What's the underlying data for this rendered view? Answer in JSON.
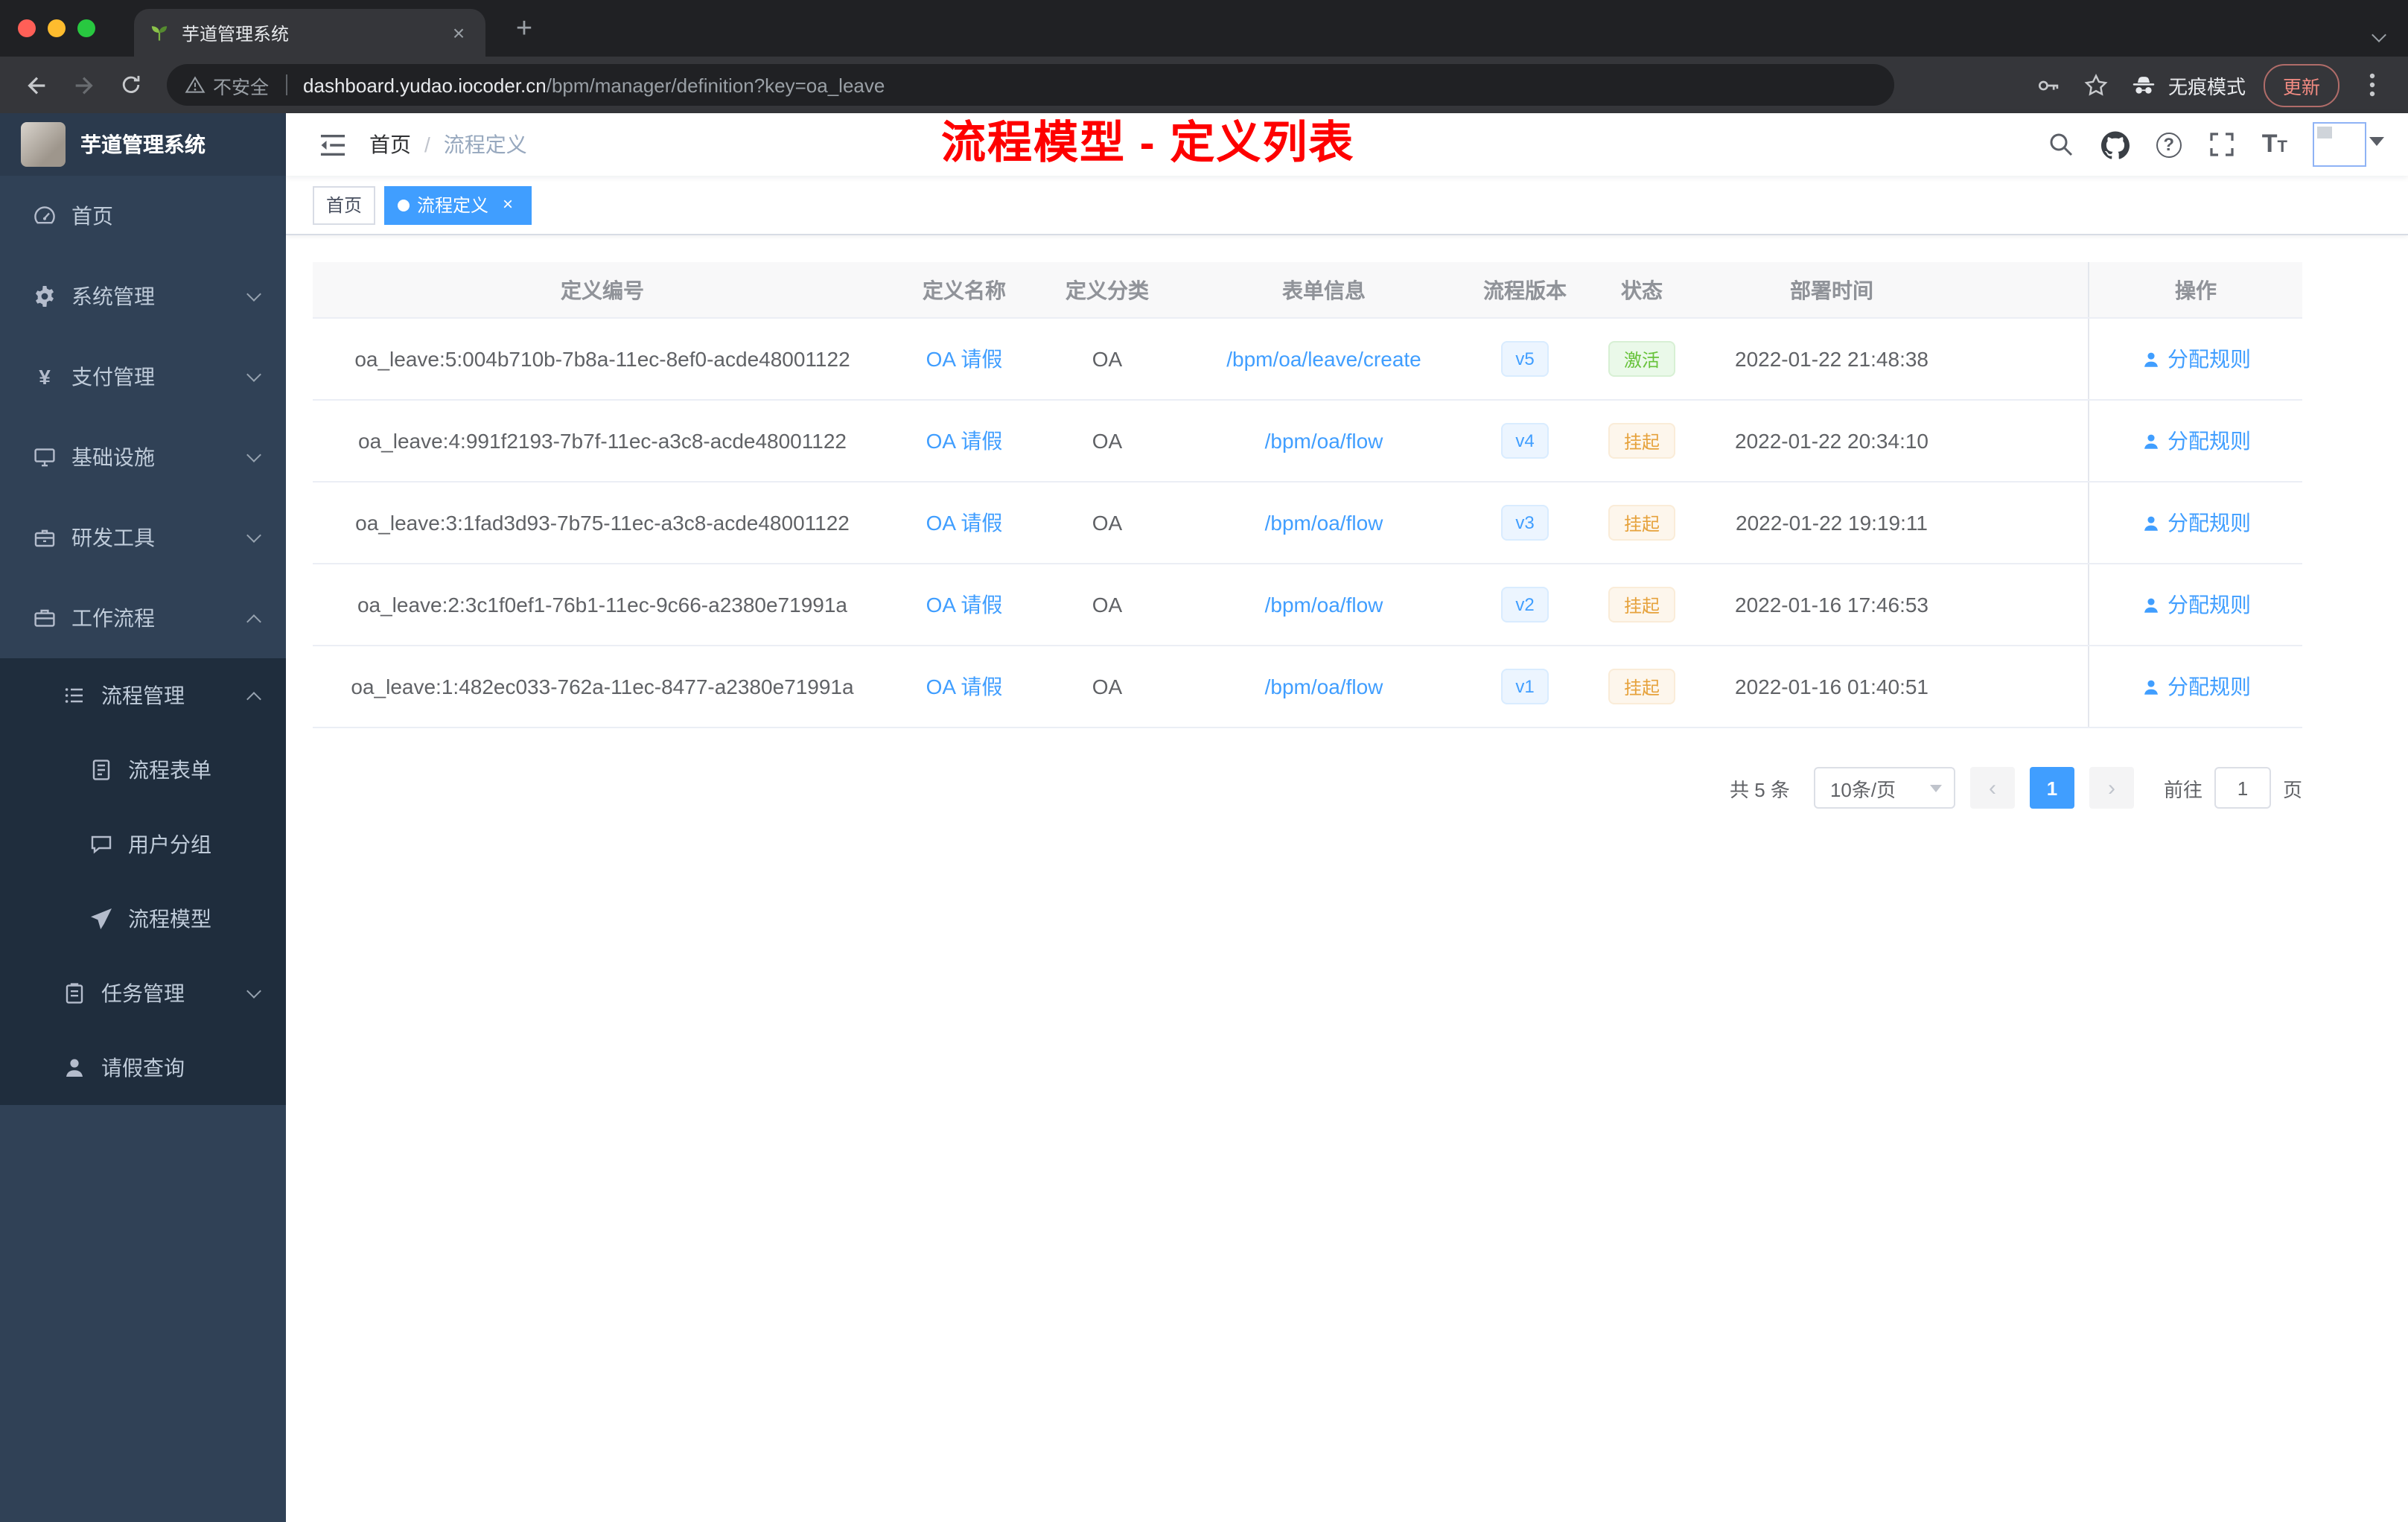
{
  "browser": {
    "tab_title": "芋道管理系统",
    "security_label": "不安全",
    "url_domain": "dashboard.yudao.iocoder.cn",
    "url_path": "/bpm/manager/definition?key=oa_leave",
    "incognito_label": "无痕模式",
    "update_label": "更新"
  },
  "icons": {
    "tab_close": "×",
    "new_tab": "+",
    "tag_close": "×",
    "question_mark": "?",
    "prev_arrow": "‹",
    "next_arrow": "›",
    "font_size_big": "T",
    "font_size_small": "T",
    "yen": "¥"
  },
  "sidebar": {
    "title": "芋道管理系统",
    "items": [
      {
        "label": "首页"
      },
      {
        "label": "系统管理",
        "arrow": "down"
      },
      {
        "label": "支付管理",
        "arrow": "down"
      },
      {
        "label": "基础设施",
        "arrow": "down"
      },
      {
        "label": "研发工具",
        "arrow": "down"
      },
      {
        "label": "工作流程",
        "arrow": "up"
      },
      {
        "label": "流程管理",
        "arrow": "up"
      },
      {
        "label": "流程表单"
      },
      {
        "label": "用户分组"
      },
      {
        "label": "流程模型"
      },
      {
        "label": "任务管理",
        "arrow": "down"
      },
      {
        "label": "请假查询"
      }
    ]
  },
  "header": {
    "breadcrumb_home": "首页",
    "breadcrumb_separator": "/",
    "breadcrumb_current": "流程定义",
    "annotation": "流程模型 - 定义列表"
  },
  "tags_view": {
    "home": "首页",
    "active": "流程定义"
  },
  "table": {
    "columns": [
      "定义编号",
      "定义名称",
      "定义分类",
      "表单信息",
      "流程版本",
      "状态",
      "部署时间",
      "操作"
    ],
    "rows": [
      {
        "id": "oa_leave:5:004b710b-7b8a-11ec-8ef0-acde48001122",
        "name": "OA 请假",
        "category": "OA",
        "form": "/bpm/oa/leave/create",
        "version": "v5",
        "status": "激活",
        "status_type": "success",
        "deploy_time": "2022-01-22 21:48:38",
        "action": "分配规则"
      },
      {
        "id": "oa_leave:4:991f2193-7b7f-11ec-a3c8-acde48001122",
        "name": "OA 请假",
        "category": "OA",
        "form": "/bpm/oa/flow",
        "version": "v4",
        "status": "挂起",
        "status_type": "warning",
        "deploy_time": "2022-01-22 20:34:10",
        "action": "分配规则"
      },
      {
        "id": "oa_leave:3:1fad3d93-7b75-11ec-a3c8-acde48001122",
        "name": "OA 请假",
        "category": "OA",
        "form": "/bpm/oa/flow",
        "version": "v3",
        "status": "挂起",
        "status_type": "warning",
        "deploy_time": "2022-01-22 19:19:11",
        "action": "分配规则"
      },
      {
        "id": "oa_leave:2:3c1f0ef1-76b1-11ec-9c66-a2380e71991a",
        "name": "OA 请假",
        "category": "OA",
        "form": "/bpm/oa/flow",
        "version": "v2",
        "status": "挂起",
        "status_type": "warning",
        "deploy_time": "2022-01-16 17:46:53",
        "action": "分配规则"
      },
      {
        "id": "oa_leave:1:482ec033-762a-11ec-8477-a2380e71991a",
        "name": "OA 请假",
        "category": "OA",
        "form": "/bpm/oa/flow",
        "version": "v1",
        "status": "挂起",
        "status_type": "warning",
        "deploy_time": "2022-01-16 01:40:51",
        "action": "分配规则"
      }
    ]
  },
  "pagination": {
    "total": "共 5 条",
    "page_size": "10条/页",
    "current_page": "1",
    "goto_label": "前往",
    "goto_value": "1",
    "page_unit": "页"
  },
  "colors": {
    "accent": "#409eff",
    "success_text": "#67c23a",
    "warning_text": "#e6a23c",
    "annotation_red": "#fe0000",
    "update_red": "#f28b82",
    "sidebar_bg": "#304156",
    "submenu_bg": "#1f2d3d"
  }
}
